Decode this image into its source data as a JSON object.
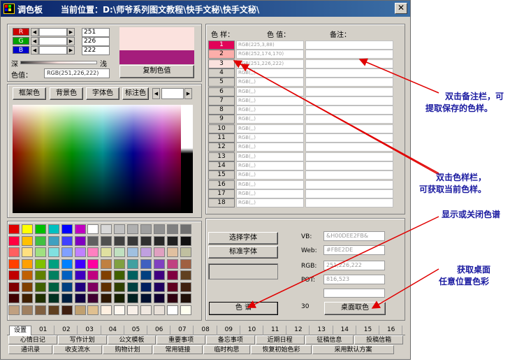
{
  "window": {
    "title": "调色板",
    "location_label": "当前位置：",
    "location_path": "D:\\师爷系列图文教程\\快手文秘\\快手文秘\\",
    "close_glyph": "✕",
    "app_icon": "palette-app-icon"
  },
  "rgb_controls": {
    "r_label": "R",
    "g_label": "G",
    "b_label": "B",
    "r_value": "251",
    "g_value": "226",
    "b_value": "222",
    "r_color": "#cc0000",
    "g_color": "#00a000",
    "b_color": "#0000cc",
    "deep_label": "深",
    "light_label": "浅",
    "color_value_label": "色值：",
    "color_value": "RGB(251,226,222)",
    "copy_button": "复制色值",
    "preview_top_color": "#fbe2de",
    "preview_bottom_color": "#a51d7c"
  },
  "color_tabs": {
    "frame_color": "框架色",
    "background_color": "背景色",
    "font_color": "字体色",
    "mark_color": "标注色"
  },
  "saved_table": {
    "header_swatch": "色 样：",
    "header_value": "色 值：",
    "header_note": "备注：",
    "rows": [
      {
        "num": "1",
        "value": "RGB(225,3,88)",
        "color": "#e10358"
      },
      {
        "num": "2",
        "value": "RGB(252,174,170)",
        "color": "#fcaeaa"
      },
      {
        "num": "3",
        "value": "RGB(251,226,222)",
        "color": "#fbe2de"
      },
      {
        "num": "4",
        "value": "RGB(,,)",
        "color": "#d4d0c8"
      },
      {
        "num": "5",
        "value": "RGB(,,)",
        "color": "#d4d0c8"
      },
      {
        "num": "6",
        "value": "RGB(,,)",
        "color": "#d4d0c8"
      },
      {
        "num": "7",
        "value": "RGB(,,)",
        "color": "#d4d0c8"
      },
      {
        "num": "8",
        "value": "RGB(,,)",
        "color": "#d4d0c8"
      },
      {
        "num": "9",
        "value": "RGB(,,)",
        "color": "#d4d0c8"
      },
      {
        "num": "10",
        "value": "RGB(,,)",
        "color": "#d4d0c8"
      },
      {
        "num": "11",
        "value": "RGB(,,)",
        "color": "#d4d0c8"
      },
      {
        "num": "12",
        "value": "RGB(,,)",
        "color": "#d4d0c8"
      },
      {
        "num": "13",
        "value": "RGB(,,)",
        "color": "#d4d0c8"
      },
      {
        "num": "14",
        "value": "RGB(,,)",
        "color": "#d4d0c8"
      },
      {
        "num": "15",
        "value": "RGB(,,)",
        "color": "#d4d0c8"
      },
      {
        "num": "16",
        "value": "RGB(,,)",
        "color": "#d4d0c8"
      },
      {
        "num": "17",
        "value": "RGB(,,)",
        "color": "#d4d0c8"
      },
      {
        "num": "18",
        "value": "RGB(,,)",
        "color": "#d4d0c8"
      }
    ]
  },
  "swatch_colors": [
    [
      "#e00000",
      "#ffff00",
      "#00c000",
      "#00c0c0",
      "#0000ff",
      "#c000c0",
      "#ffffff",
      "#d8d8d8",
      "#c0c0c0",
      "#b0b0b0",
      "#a0a0a0",
      "#909090",
      "#808080",
      "#707070"
    ],
    [
      "#ff0040",
      "#ffc000",
      "#40c040",
      "#40a0c0",
      "#4040ff",
      "#8000c0",
      "#606060",
      "#505050",
      "#404040",
      "#383838",
      "#303030",
      "#282828",
      "#202020",
      "#101010"
    ],
    [
      "#ff6060",
      "#ffe080",
      "#a0e080",
      "#80e0e0",
      "#80a0ff",
      "#c080ff",
      "#ff80c0",
      "#e0e0a0",
      "#c0e0c0",
      "#a0c0e0",
      "#c0a0e0",
      "#e0a0c0",
      "#e0c0a0",
      "#c0c0a0"
    ],
    [
      "#ff4000",
      "#ffa000",
      "#80c000",
      "#00a080",
      "#0080ff",
      "#4000ff",
      "#ff00a0",
      "#c08040",
      "#80a040",
      "#40a0a0",
      "#4060c0",
      "#8040c0",
      "#c04080",
      "#a06040"
    ],
    [
      "#c00000",
      "#c06000",
      "#608000",
      "#008060",
      "#0060c0",
      "#4000c0",
      "#c00080",
      "#804000",
      "#406000",
      "#006060",
      "#004080",
      "#400080",
      "#800040",
      "#604020"
    ],
    [
      "#800000",
      "#804000",
      "#406000",
      "#006040",
      "#004080",
      "#200080",
      "#800060",
      "#603000",
      "#304000",
      "#004040",
      "#002060",
      "#200060",
      "#600020",
      "#402010"
    ],
    [
      "#400000",
      "#402000",
      "#203000",
      "#003020",
      "#002040",
      "#100040",
      "#400030",
      "#301800",
      "#182000",
      "#002020",
      "#001030",
      "#100030",
      "#300010",
      "#201008"
    ],
    [
      "#c0a080",
      "#a08060",
      "#806040",
      "#604020",
      "#402010",
      "#c0a070",
      "#e0c090",
      "#fff0e0",
      "#fff8f0",
      "#f8f0e8",
      "#f0e8e0",
      "#e8e0d8",
      "#ffffff",
      "#fffff0"
    ]
  ],
  "font_controls": {
    "select_font": "选择字体",
    "standard_font": "标准字体",
    "spectrum_button": "色  谱"
  },
  "code_fields": {
    "vb_label": "VB:",
    "vb_value": "&H00DEE2FB&",
    "web_label": "Web:",
    "web_value": "#FBE2DE",
    "rgb_label": "RGB:",
    "rgb_value": "251,226,222",
    "pot_label": "POT:",
    "pot_value": "816,523",
    "counter": "30",
    "desktop_pick_button": "桌面取色"
  },
  "tabs": [
    "设置",
    "01",
    "02",
    "03",
    "04",
    "05",
    "06",
    "07",
    "08",
    "09",
    "10",
    "11",
    "12",
    "13",
    "14",
    "15",
    "16"
  ],
  "menu_row1": [
    "心情日记",
    "写作计划",
    "公文模板",
    "重要事项",
    "备忘事项",
    "近期日程",
    "征稿信息",
    "投稿信箱"
  ],
  "menu_row2": [
    "通讯录",
    "收支流水",
    "购物计划",
    "常用链接",
    "临时构思",
    "恢复初始色彩",
    "采用默认方案"
  ],
  "annotations": {
    "note1_line1": "双击备注栏，可",
    "note1_line2": "提取保存的色样。",
    "note2_line1": "双击色样栏，",
    "note2_line2": "可获取当前色样。",
    "note3": "显示或关闭色谱",
    "note4_line1": "获取桌面",
    "note4_line2": "任意位置色彩",
    "arrow_color": "#e00000",
    "text_color": "#1a1aa0"
  }
}
